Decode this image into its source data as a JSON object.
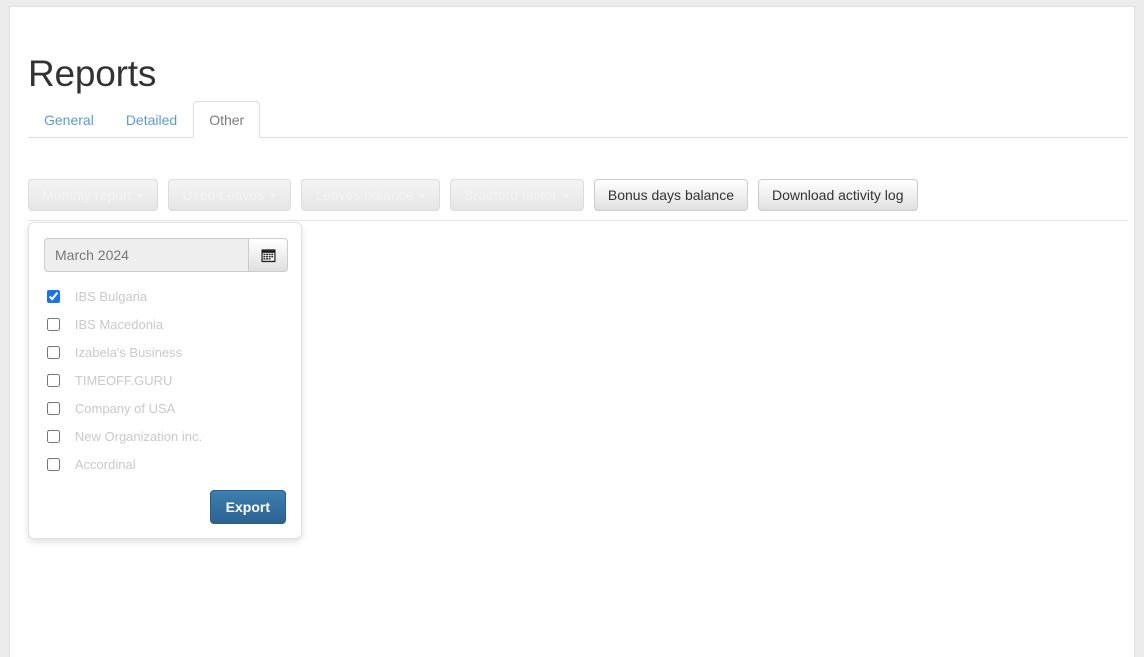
{
  "page": {
    "title": "Reports"
  },
  "tabs": [
    {
      "label": "General",
      "active": false
    },
    {
      "label": "Detailed",
      "active": false
    },
    {
      "label": "Other",
      "active": true
    }
  ],
  "report_buttons": [
    {
      "label": "Monthly report",
      "has_caret": true,
      "faded": true
    },
    {
      "label": "Used Leaves",
      "has_caret": true,
      "faded": true
    },
    {
      "label": "Leaves balance",
      "has_caret": true,
      "faded": true
    },
    {
      "label": "Bradford factor",
      "has_caret": true,
      "faded": true
    },
    {
      "label": "Bonus days balance",
      "has_caret": false,
      "faded": false
    },
    {
      "label": "Download activity log",
      "has_caret": false,
      "faded": false
    }
  ],
  "export_panel": {
    "date_value": "March 2024",
    "date_placeholder": "March 2024",
    "calendar_icon": "calendar-icon",
    "companies": [
      {
        "label": "IBS Bulgaria",
        "checked": true
      },
      {
        "label": "IBS Macedonia",
        "checked": false
      },
      {
        "label": "Izabela's Business",
        "checked": false
      },
      {
        "label": "TIMEOFF.GURU",
        "checked": false
      },
      {
        "label": "Company of USA",
        "checked": false
      },
      {
        "label": "New Organization inc.",
        "checked": false
      },
      {
        "label": "Accordinal",
        "checked": false
      }
    ],
    "export_label": "Export"
  },
  "colors": {
    "link_blue": "#5b9bd5",
    "primary_blue": "#337ab7",
    "export_button": "#2c6290",
    "checkbox_accent": "#1a73e8",
    "border_gray": "#dddddd",
    "page_background": "#ececed"
  }
}
